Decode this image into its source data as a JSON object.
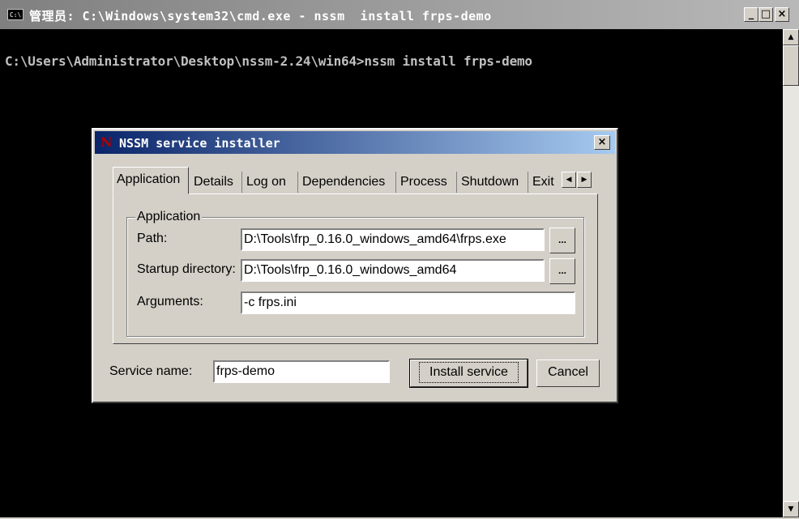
{
  "cmd": {
    "icon_text": "C:\\",
    "title": "管理员: C:\\Windows\\system32\\cmd.exe - nssm  install frps-demo",
    "console_line": "C:\\Users\\Administrator\\Desktop\\nssm-2.24\\win64>nssm install frps-demo",
    "buttons": {
      "minimize": "_",
      "maximize": "□",
      "close": "×"
    },
    "scroll_up": "▲",
    "scroll_down": "▼"
  },
  "dialog": {
    "logo": "N",
    "title": "NSSM service installer",
    "close": "×",
    "tabs": [
      "Application",
      "Details",
      "Log on",
      "Dependencies",
      "Process",
      "Shutdown",
      "Exit"
    ],
    "active_tab": "Application",
    "tab_scroll_left": "◀",
    "tab_scroll_right": "▶",
    "group_label": "Application",
    "path_label": "Path:",
    "path_value": "D:\\Tools\\frp_0.16.0_windows_amd64\\frps.exe",
    "startup_label": "Startup directory:",
    "startup_value": "D:\\Tools\\frp_0.16.0_windows_amd64",
    "arguments_label": "Arguments:",
    "arguments_value": "-c frps.ini",
    "browse_label": "...",
    "service_name_label": "Service name:",
    "service_name_value": "frps-demo",
    "install_button": "Install service",
    "cancel_button": "Cancel"
  }
}
